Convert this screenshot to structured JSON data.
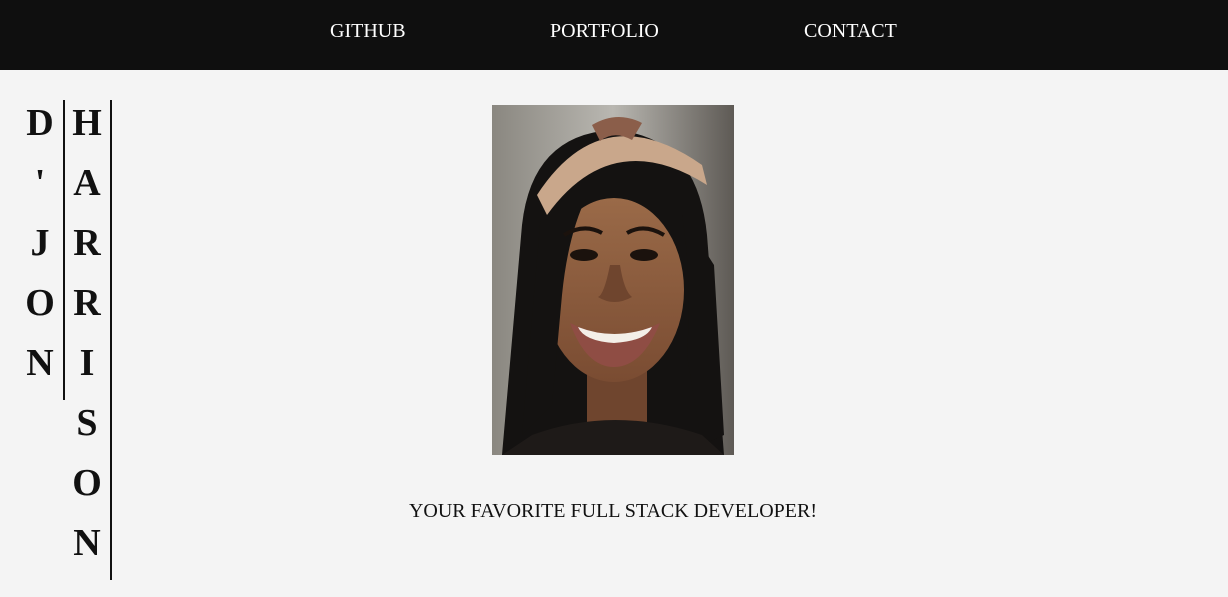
{
  "nav": {
    "links": [
      {
        "label": "GITHUB"
      },
      {
        "label": "PORTFOLIO"
      },
      {
        "label": "CONTACT"
      }
    ]
  },
  "name": {
    "first": [
      "D",
      "'",
      "J",
      "O",
      "N"
    ],
    "last": [
      "H",
      "A",
      "R",
      "R",
      "I",
      "S",
      "O",
      "N"
    ]
  },
  "profile_image": {
    "alt": "Profile photo of D'Jon Harrison"
  },
  "tagline": "YOUR FAVORITE FULL STACK DEVELOPER!",
  "colors": {
    "navbar_bg": "#0f0f0f",
    "page_bg": "#f4f4f4",
    "text": "#111111",
    "nav_text": "#ffffff"
  }
}
